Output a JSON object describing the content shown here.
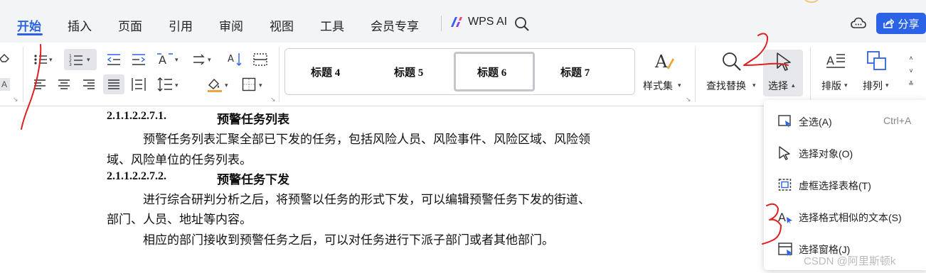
{
  "menubar": {
    "tabs": [
      "开始",
      "插入",
      "页面",
      "引用",
      "审阅",
      "视图",
      "工具",
      "会员专享"
    ],
    "wps_ai_label": "WPS AI",
    "share_label": "分享",
    "accent": "#2b62e6"
  },
  "ribbon": {
    "styles": [
      "标题 4",
      "标题 5",
      "标题 6",
      "标题 7"
    ],
    "selected_style": "标题 6",
    "style_set_label": "样式集",
    "find_replace_label": "查找替换",
    "select_label": "选择",
    "arrange_label": "排版",
    "align_label": "排列"
  },
  "document": {
    "h1_num": "2.1.1.2.2.7.1.",
    "h1_title": "预警任务列表",
    "p1_line1": "预警任务列表汇聚全部已下发的任务，包括风险人员、风险事件、风险区域、风险领",
    "p1_line2": "域、风险单位的任务列表。",
    "h2_num": "2.1.1.2.2.7.2.",
    "h2_title": "预警任务下发",
    "p2_line1": "进行综合研判分析之后，将预警以任务的形式下发，可以编辑预警任务下发的街道、",
    "p2_line2": "部门、人员、地址等内容。",
    "p3_line1": "相应的部门接收到预警任务之后，可以对任务进行下派子部门或者其他部门。"
  },
  "select_menu": {
    "items": [
      {
        "label": "全选(A)",
        "shortcut": "Ctrl+A",
        "icon": "select-all-icon"
      },
      {
        "label": "选择对象(O)",
        "shortcut": "",
        "icon": "select-object-icon"
      },
      {
        "label": "虚框选择表格(T)",
        "shortcut": "",
        "icon": "dashed-box-select-icon"
      },
      {
        "label": "选择格式相似的文本(S)",
        "shortcut": "",
        "icon": "select-similar-format-icon"
      },
      {
        "label": "选择窗格(J)",
        "shortcut": "",
        "icon": "selection-pane-icon"
      }
    ]
  },
  "annotations": {
    "marks": [
      "1",
      "2",
      "3"
    ],
    "color": "#e02020"
  },
  "watermark": "CSDN @阿里斯顿k"
}
